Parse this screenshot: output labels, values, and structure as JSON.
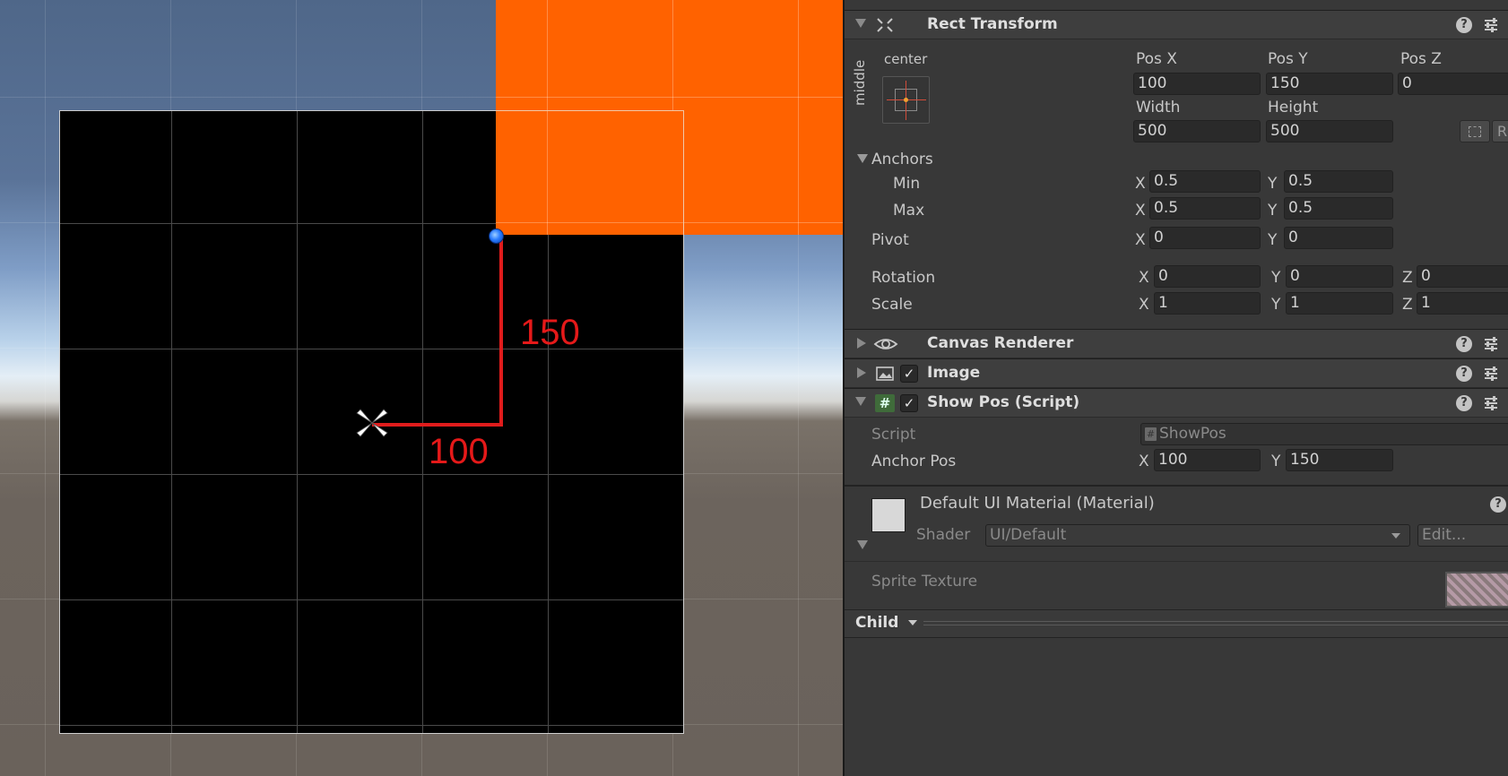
{
  "scene": {
    "measure_x": "100",
    "measure_y": "150"
  },
  "inspector": {
    "rect_transform": {
      "title": "Rect Transform",
      "anchor_h": "center",
      "anchor_v": "middle",
      "pos_x_label": "Pos X",
      "pos_y_label": "Pos Y",
      "pos_z_label": "Pos Z",
      "pos_x": "100",
      "pos_y": "150",
      "pos_z": "0",
      "width_label": "Width",
      "height_label": "Height",
      "width": "500",
      "height": "500",
      "r_button": "R",
      "anchors_label": "Anchors",
      "min_label": "Min",
      "max_label": "Max",
      "min_x": "0.5",
      "min_y": "0.5",
      "max_x": "0.5",
      "max_y": "0.5",
      "pivot_label": "Pivot",
      "pivot_x": "0",
      "pivot_y": "0",
      "rotation_label": "Rotation",
      "rot_x": "0",
      "rot_y": "0",
      "rot_z": "0",
      "scale_label": "Scale",
      "scale_x": "1",
      "scale_y": "1",
      "scale_z": "1",
      "x": "X",
      "y": "Y",
      "z": "Z"
    },
    "canvas_renderer": {
      "title": "Canvas Renderer"
    },
    "image": {
      "title": "Image",
      "enabled": "✓"
    },
    "show_pos": {
      "title": "Show Pos (Script)",
      "enabled": "✓",
      "script_label": "Script",
      "script_value": "ShowPos",
      "anchor_pos_label": "Anchor Pos",
      "anchor_x": "100",
      "anchor_y": "150"
    },
    "material": {
      "title": "Default UI Material (Material)",
      "shader_label": "Shader",
      "shader_value": "UI/Default",
      "edit_button": "Edit...",
      "sprite_texture_label": "Sprite Texture"
    },
    "child_tab": "Child"
  },
  "icons": {
    "help": "?",
    "foldout_open": "triangle-down",
    "foldout_closed": "triangle-right"
  }
}
